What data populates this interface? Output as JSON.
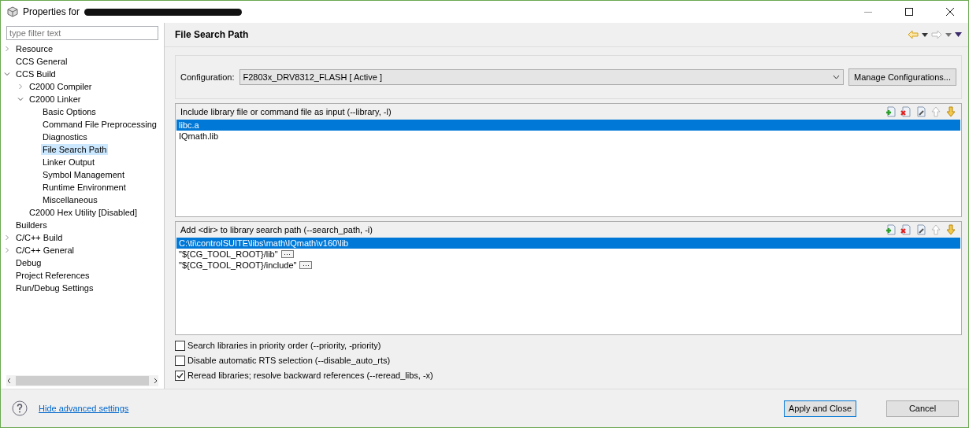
{
  "window": {
    "title": "Properties for"
  },
  "filter": {
    "placeholder": "type filter text"
  },
  "tree": [
    {
      "label": "Resource",
      "expanded": false,
      "selected": false
    },
    {
      "label": "CCS General",
      "selected": false
    },
    {
      "label": "CCS Build",
      "expanded": true,
      "selected": false,
      "children": [
        {
          "label": "C2000 Compiler",
          "expanded": false,
          "selected": false
        },
        {
          "label": "C2000 Linker",
          "expanded": true,
          "selected": false,
          "children": [
            {
              "label": "Basic Options",
              "selected": false
            },
            {
              "label": "Command File Preprocessing",
              "selected": false
            },
            {
              "label": "Diagnostics",
              "selected": false
            },
            {
              "label": "File Search Path",
              "selected": true
            },
            {
              "label": "Linker Output",
              "selected": false
            },
            {
              "label": "Symbol Management",
              "selected": false
            },
            {
              "label": "Runtime Environment",
              "selected": false
            },
            {
              "label": "Miscellaneous",
              "selected": false
            }
          ]
        },
        {
          "label": "C2000 Hex Utility  [Disabled]",
          "selected": false
        }
      ]
    },
    {
      "label": "Builders",
      "selected": false
    },
    {
      "label": "C/C++ Build",
      "expanded": false,
      "selected": false
    },
    {
      "label": "C/C++ General",
      "expanded": false,
      "selected": false
    },
    {
      "label": "Debug",
      "selected": false
    },
    {
      "label": "Project References",
      "selected": false
    },
    {
      "label": "Run/Debug Settings",
      "selected": false
    }
  ],
  "page": {
    "title": "File Search Path"
  },
  "configuration": {
    "label": "Configuration:",
    "value": "F2803x_DRV8312_FLASH  [ Active ]",
    "button": "Manage Configurations..."
  },
  "lists": [
    {
      "title": "Include library file or command file as input (--library, -l)",
      "items": [
        {
          "text": "libc.a",
          "selected": true,
          "edit_button": false
        },
        {
          "text": "IQmath.lib",
          "selected": false,
          "edit_button": false
        }
      ]
    },
    {
      "title": "Add <dir> to library search path (--search_path, -i)",
      "items": [
        {
          "text": "C:\\ti\\controlSUITE\\libs\\math\\IQmath\\v160\\lib",
          "selected": true,
          "edit_button": false
        },
        {
          "text": "\"${CG_TOOL_ROOT}/lib\"",
          "selected": false,
          "edit_button": true
        },
        {
          "text": "\"${CG_TOOL_ROOT}/include\"",
          "selected": false,
          "edit_button": true
        }
      ]
    }
  ],
  "options": [
    {
      "label": "Search libraries in priority order (--priority, -priority)",
      "checked": false
    },
    {
      "label": "Disable automatic RTS selection (--disable_auto_rts)",
      "checked": false
    },
    {
      "label": "Reread libraries; resolve backward references (--reread_libs, -x)",
      "checked": true
    }
  ],
  "footer": {
    "link": "Hide advanced settings",
    "buttons": [
      {
        "label": "Apply and Close",
        "default": true
      },
      {
        "label": "Cancel",
        "default": false
      }
    ]
  }
}
